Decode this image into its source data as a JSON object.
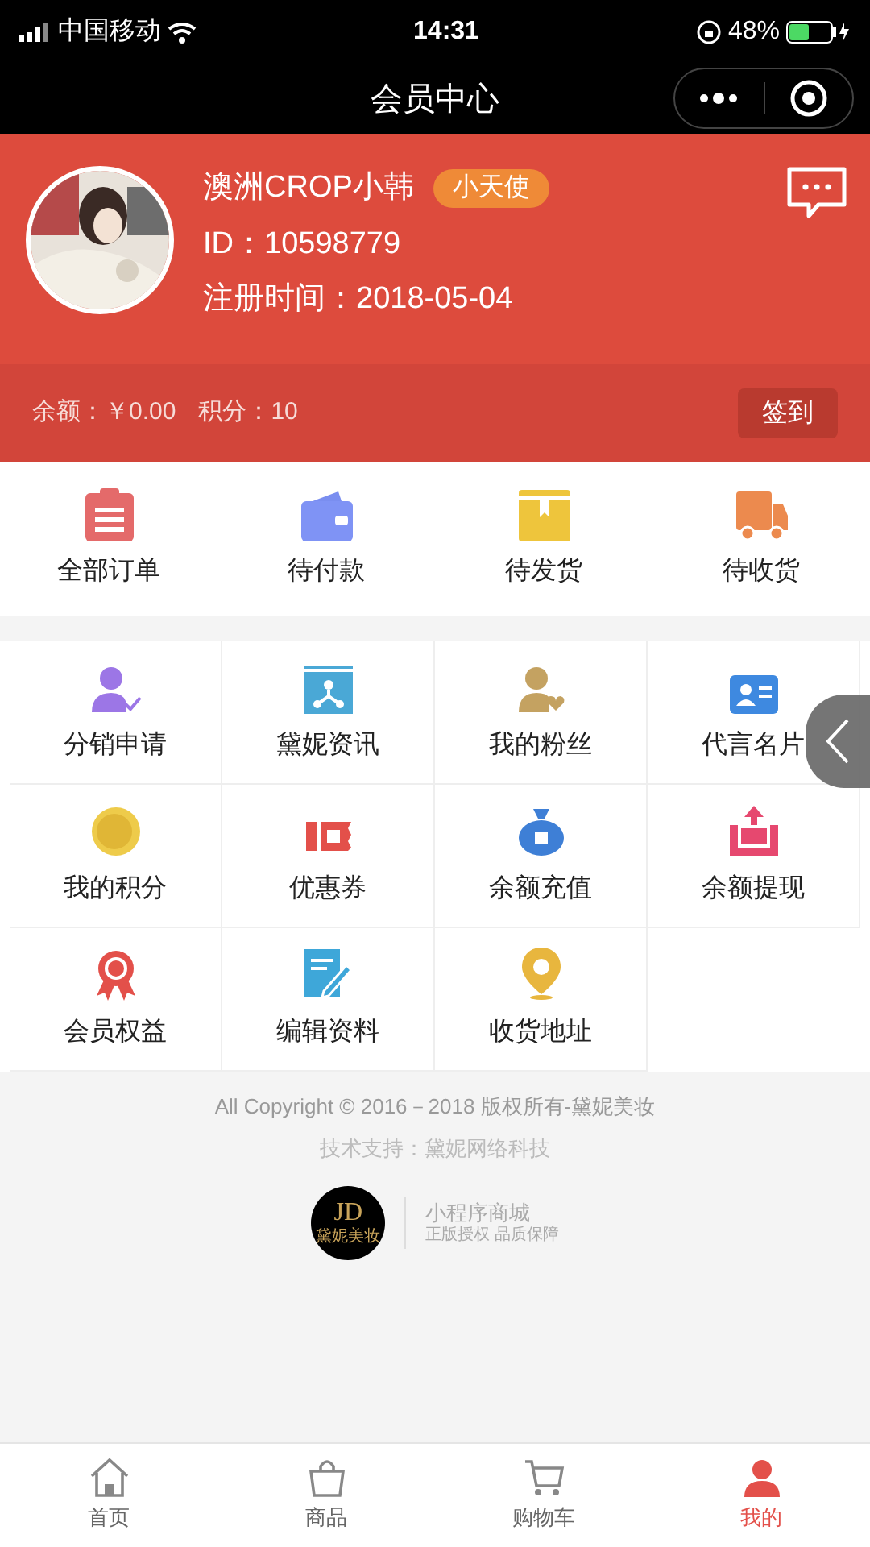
{
  "status_bar": {
    "carrier": "中国移动",
    "time": "14:31",
    "battery": "48%"
  },
  "nav": {
    "title": "会员中心"
  },
  "profile": {
    "name": "澳洲CROP小韩",
    "badge": "小天使",
    "id": "ID：10598779",
    "registered": "注册时间：2018-05-04"
  },
  "wallet": {
    "balance": "余额：￥0.00",
    "points": "积分：10",
    "checkin_button": "签到"
  },
  "orders": [
    {
      "label": "全部订单"
    },
    {
      "label": "待付款"
    },
    {
      "label": "待发货"
    },
    {
      "label": "待收货"
    }
  ],
  "services": [
    {
      "label": "分销申请"
    },
    {
      "label": "黛妮资讯"
    },
    {
      "label": "我的粉丝"
    },
    {
      "label": "代言名片"
    },
    {
      "label": "我的积分"
    },
    {
      "label": "优惠券"
    },
    {
      "label": "余额充值"
    },
    {
      "label": "余额提现"
    },
    {
      "label": "会员权益"
    },
    {
      "label": "编辑资料"
    },
    {
      "label": "收货地址"
    }
  ],
  "footer": {
    "copyright": "All Copyright © 2016－2018 版权所有-黛妮美妆",
    "support": "技术支持：黛妮网络科技",
    "logo_mark": "JD",
    "logo_caption": "黛妮美妆",
    "store_title": "小程序商城",
    "store_subtitle": "正版授权 品质保障"
  },
  "tab_bar": [
    {
      "label": "首页",
      "selected": false
    },
    {
      "label": "商品",
      "selected": false
    },
    {
      "label": "购物车",
      "selected": false
    },
    {
      "label": "我的",
      "selected": true
    }
  ]
}
